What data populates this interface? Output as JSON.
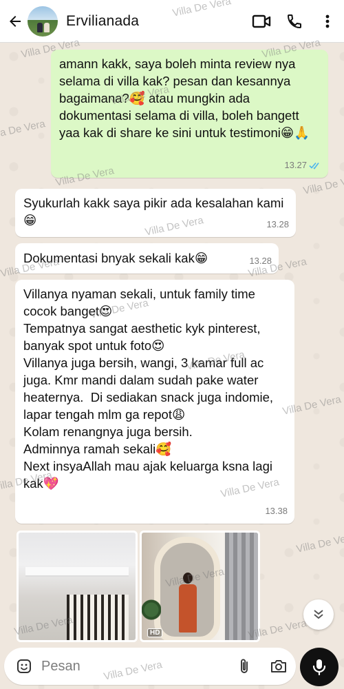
{
  "header": {
    "contact_name": "Ervilianada"
  },
  "messages": [
    {
      "direction": "outgoing",
      "text": "amann kakk, saya boleh minta review nya selama di villa kak? pesan dan kesannya bagaimana?🥰 atau mungkin ada dokumentasi selama di villa, boleh bangett yaa kak di share ke sini untuk testimoni😁🙏",
      "time": "13.27",
      "status": "read"
    },
    {
      "direction": "incoming",
      "text": "Syukurlah kakk saya pikir ada kesalahan kami😁",
      "time": "13.28"
    },
    {
      "direction": "incoming",
      "text": "Dokumentasi bnyak sekali kak😁",
      "time": "13.28"
    },
    {
      "direction": "incoming",
      "text": "Villanya nyaman sekali, untuk family time cocok banget😍\nTempatnya sangat aesthetic kyk pinterest, banyak spot untuk foto😍\nVillanya juga bersih, wangi, 3 kamar full ac juga. Kmr mandi dalam sudah pake water heaternya.  Di sediakan snack juga indomie, lapar tengah mlm ga repot😩\nKolam renangnya juga bersih.\nAdminnya ramah sekali🥰\nNext insyaAllah mau ajak keluarga ksna lagi kak💖",
      "time": "13.38"
    }
  ],
  "media": {
    "hd_label": "HD"
  },
  "composer": {
    "placeholder": "Pesan"
  },
  "watermark": "Villa De Vera",
  "colors": {
    "outgoing_bubble": "#dcf8c6",
    "incoming_bubble": "#ffffff",
    "read_ticks": "#4fb6ec",
    "mic_button": "#111111"
  },
  "icons": [
    "back-arrow-icon",
    "video-call-icon",
    "phone-icon",
    "more-vert-icon",
    "double-check-icon",
    "emoji-icon",
    "attach-icon",
    "camera-icon",
    "mic-icon",
    "chevron-double-down-icon"
  ]
}
